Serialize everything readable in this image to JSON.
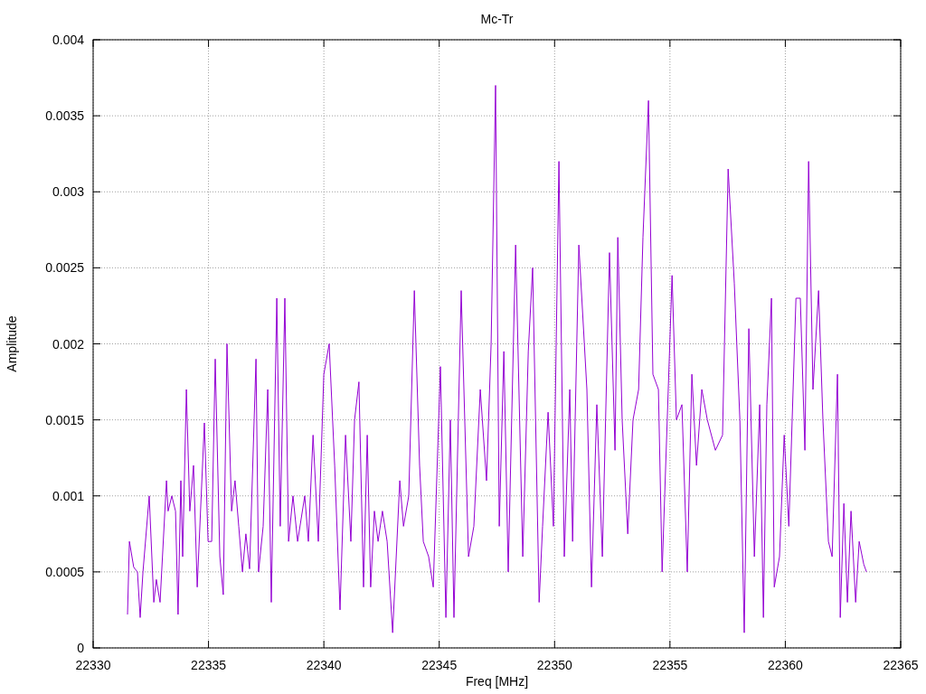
{
  "chart_data": {
    "type": "line",
    "title": "Mc-Tr",
    "xlabel": "Freq [MHz]",
    "ylabel": "Amplitude",
    "xlim": [
      22330,
      22365
    ],
    "ylim": [
      0,
      0.004
    ],
    "grid": true,
    "xticks": [
      22330,
      22335,
      22340,
      22345,
      22350,
      22355,
      22360,
      22365
    ],
    "yticks": [
      0,
      0.0005,
      0.001,
      0.0015,
      0.002,
      0.0025,
      0.003,
      0.0035,
      0.004
    ],
    "x": [
      22331.49,
      22331.57,
      22331.76,
      22331.92,
      22332.04,
      22332.16,
      22332.43,
      22332.63,
      22332.74,
      22332.9,
      22333.18,
      22333.25,
      22333.41,
      22333.57,
      22333.68,
      22333.8,
      22333.88,
      22334.04,
      22334.19,
      22334.35,
      22334.51,
      22334.82,
      22334.98,
      22335.14,
      22335.29,
      22335.49,
      22335.64,
      22335.8,
      22336.0,
      22336.15,
      22336.31,
      22336.47,
      22336.62,
      22336.78,
      22337.06,
      22337.17,
      22337.37,
      22337.57,
      22337.72,
      22337.96,
      22338.11,
      22338.31,
      22338.47,
      22338.66,
      22338.86,
      22339.17,
      22339.33,
      22339.53,
      22339.76,
      22340.0,
      22340.23,
      22340.47,
      22340.7,
      22340.94,
      22341.17,
      22341.33,
      22341.52,
      22341.72,
      22341.88,
      22342.03,
      22342.19,
      22342.35,
      22342.54,
      22342.74,
      22342.98,
      22343.29,
      22343.45,
      22343.68,
      22343.92,
      22344.15,
      22344.31,
      22344.54,
      22344.74,
      22345.05,
      22345.29,
      22345.48,
      22345.64,
      22345.95,
      22346.27,
      22346.5,
      22346.78,
      22347.05,
      22347.25,
      22347.44,
      22347.6,
      22347.8,
      22347.99,
      22348.31,
      22348.62,
      22348.86,
      22349.05,
      22349.33,
      22349.48,
      22349.72,
      22349.95,
      22350.19,
      22350.42,
      22350.66,
      22350.78,
      22351.05,
      22351.4,
      22351.6,
      22351.83,
      22352.07,
      22352.38,
      22352.62,
      22352.74,
      22352.93,
      22353.17,
      22353.4,
      22353.64,
      22353.83,
      22354.07,
      22354.26,
      22354.5,
      22354.66,
      22355.09,
      22355.28,
      22355.52,
      22355.75,
      22355.95,
      22356.15,
      22356.38,
      22356.62,
      22356.97,
      22357.28,
      22357.52,
      22357.79,
      22358.03,
      22358.22,
      22358.42,
      22358.66,
      22358.89,
      22359.05,
      22359.2,
      22359.4,
      22359.52,
      22359.75,
      22359.95,
      22360.15,
      22360.46,
      22360.65,
      22360.85,
      22361.01,
      22361.2,
      22361.44,
      22361.63,
      22361.87,
      22362.03,
      22362.26,
      22362.38,
      22362.54,
      22362.69,
      22362.85,
      22363.05,
      22363.2,
      22363.4,
      22363.52
    ],
    "series": [
      {
        "color": "#9400d3",
        "values": [
          0.00022,
          0.0007,
          0.00053,
          0.0005,
          0.0002,
          0.0005,
          0.001,
          0.0003,
          0.00045,
          0.0003,
          0.0011,
          0.0009,
          0.001,
          0.0009,
          0.00022,
          0.0011,
          0.0006,
          0.0017,
          0.0009,
          0.0012,
          0.0004,
          0.00148,
          0.0007,
          0.0007,
          0.0019,
          0.0006,
          0.00035,
          0.002,
          0.0009,
          0.0011,
          0.0008,
          0.0005,
          0.00075,
          0.00052,
          0.0019,
          0.0005,
          0.0008,
          0.0017,
          0.0003,
          0.0023,
          0.0008,
          0.0023,
          0.0007,
          0.001,
          0.0007,
          0.001,
          0.0007,
          0.0014,
          0.0007,
          0.0018,
          0.002,
          0.0012,
          0.00025,
          0.0014,
          0.0007,
          0.0015,
          0.00175,
          0.0004,
          0.0014,
          0.0004,
          0.0009,
          0.0007,
          0.0009,
          0.0007,
          0.0001,
          0.0011,
          0.0008,
          0.001,
          0.00235,
          0.0012,
          0.0007,
          0.0006,
          0.0004,
          0.00185,
          0.0002,
          0.0015,
          0.0002,
          0.00235,
          0.0006,
          0.0008,
          0.0017,
          0.0011,
          0.002,
          0.0037,
          0.0008,
          0.00195,
          0.0005,
          0.00265,
          0.0006,
          0.00195,
          0.0025,
          0.0003,
          0.0008,
          0.00155,
          0.0008,
          0.0032,
          0.0006,
          0.0017,
          0.0007,
          0.00265,
          0.0017,
          0.0004,
          0.0016,
          0.0006,
          0.0026,
          0.0013,
          0.0027,
          0.0015,
          0.00075,
          0.0015,
          0.0017,
          0.0027,
          0.0036,
          0.0018,
          0.0017,
          0.0005,
          0.00245,
          0.0015,
          0.0016,
          0.0005,
          0.0018,
          0.0012,
          0.0017,
          0.0015,
          0.0013,
          0.0014,
          0.00315,
          0.0024,
          0.0015,
          0.0001,
          0.0021,
          0.0006,
          0.0016,
          0.0002,
          0.0016,
          0.0023,
          0.0004,
          0.0006,
          0.0014,
          0.0008,
          0.0023,
          0.0023,
          0.0013,
          0.0032,
          0.0017,
          0.00235,
          0.0015,
          0.0007,
          0.0006,
          0.0018,
          0.0002,
          0.00095,
          0.0003,
          0.0009,
          0.0003,
          0.0007,
          0.00055,
          0.0005
        ]
      }
    ]
  }
}
